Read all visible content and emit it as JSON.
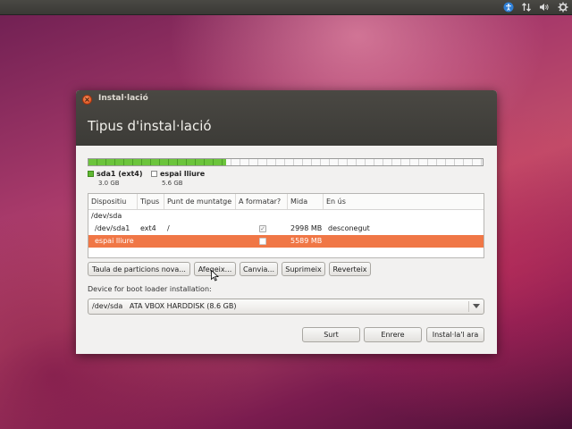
{
  "window": {
    "title": "Instal·lació",
    "page_title": "Tipus d'instal·lació"
  },
  "partition_bar": {
    "used_fraction": 0.35
  },
  "legend": [
    {
      "name": "sda1 (ext4)",
      "size": "3.0 GB",
      "color": "#60b833"
    },
    {
      "name": "espai lliure",
      "size": "5.6 GB",
      "color": "#ffffff"
    }
  ],
  "table": {
    "columns": [
      "Dispositiu",
      "Tipus",
      "Punt de muntatge",
      "A formatar?",
      "Mida",
      "En ús"
    ],
    "rows": [
      {
        "device": "/dev/sda",
        "type": "",
        "mount": "",
        "format": null,
        "size": "",
        "used": ""
      },
      {
        "device": "/dev/sda1",
        "type": "ext4",
        "mount": "/",
        "format": true,
        "size": "2998 MB",
        "used": "desconegut"
      },
      {
        "device": "espai lliure",
        "type": "",
        "mount": "",
        "format": false,
        "size": "5589 MB",
        "used": "",
        "selected": true
      }
    ]
  },
  "buttons": {
    "new_table": "Taula de particions nova...",
    "add": "Afegeix...",
    "change": "Canvia...",
    "delete": "Suprimeix",
    "revert": "Reverteix",
    "quit": "Surt",
    "back": "Enrere",
    "install": "Instal·la'l ara"
  },
  "boot_loader": {
    "label": "Device for boot loader installation:",
    "device": "/dev/sda",
    "description": "ATA VBOX HARDDISK (8.6 GB)"
  },
  "colors": {
    "selection": "#f07746",
    "accent": "#df4a16"
  }
}
